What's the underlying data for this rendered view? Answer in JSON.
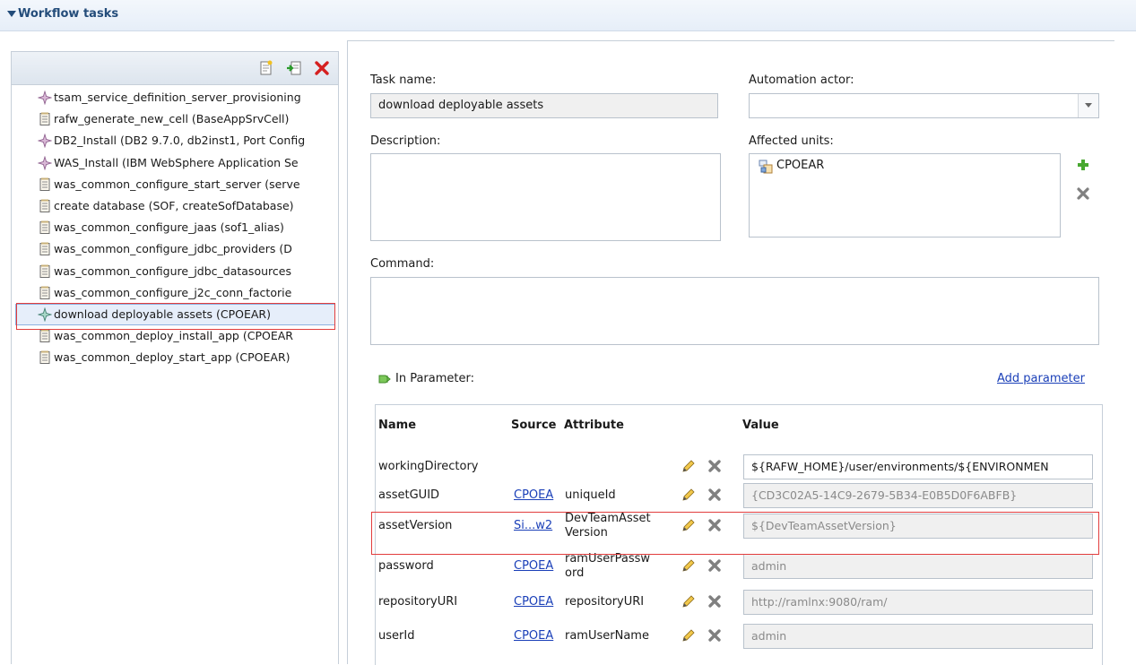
{
  "header": {
    "title": "Workflow tasks"
  },
  "tasks": [
    {
      "label": "tsam_service_definition_server_provisioning",
      "icon": "step-icon"
    },
    {
      "label": "rafw_generate_new_cell (BaseAppSrvCell)",
      "icon": "script-icon"
    },
    {
      "label": "DB2_Install (DB2 9.7.0, db2inst1, Port Config",
      "icon": "step-icon"
    },
    {
      "label": "WAS_Install (IBM WebSphere Application Se",
      "icon": "step-icon"
    },
    {
      "label": "was_common_configure_start_server (serve",
      "icon": "script-icon"
    },
    {
      "label": "create database (SOF, createSofDatabase)",
      "icon": "script-icon"
    },
    {
      "label": "was_common_configure_jaas (sof1_alias)",
      "icon": "script-icon"
    },
    {
      "label": "was_common_configure_jdbc_providers (D",
      "icon": "script-icon"
    },
    {
      "label": "was_common_configure_jdbc_datasources",
      "icon": "script-icon"
    },
    {
      "label": "was_common_configure_j2c_conn_factorie",
      "icon": "script-icon"
    },
    {
      "label": "download deployable assets (CPOEAR)",
      "icon": "step-icon"
    },
    {
      "label": "was_common_deploy_install_app (CPOEAR",
      "icon": "script-icon"
    },
    {
      "label": "was_common_deploy_start_app (CPOEAR)",
      "icon": "script-icon"
    }
  ],
  "details": {
    "task_name_label": "Task name:",
    "task_name_value": "download deployable assets",
    "automation_actor_label": "Automation actor:",
    "automation_actor_value": "",
    "description_label": "Description:",
    "description_value": "",
    "affected_units_label": "Affected units:",
    "affected_unit": "CPOEAR",
    "command_label": "Command:",
    "command_value": ""
  },
  "parameters": {
    "section_label": "In Parameter:",
    "add_label": "Add parameter",
    "columns": {
      "name": "Name",
      "source": "Source",
      "attribute": "Attribute",
      "value": "Value"
    },
    "rows": [
      {
        "name": "workingDirectory",
        "source": "",
        "attr1": "",
        "attr2": "",
        "value": "${RAFW_HOME}/user/environments/${ENVIRONMEN"
      },
      {
        "name": "assetGUID",
        "source": "CPOEA",
        "attr1": "uniqueId",
        "attr2": "",
        "value": "{CD3C02A5-14C9-2679-5B34-E0B5D0F6ABFB}"
      },
      {
        "name": "assetVersion",
        "source": "Si...w2",
        "attr1": "DevTeamAsset",
        "attr2": "Version",
        "value": "${DevTeamAssetVersion}"
      },
      {
        "name": "password",
        "source": "CPOEA",
        "attr1": "ramUserPassw",
        "attr2": "ord",
        "value": "admin"
      },
      {
        "name": "repositoryURI",
        "source": "CPOEA",
        "attr1": "repositoryURI",
        "attr2": "",
        "value": "http://ramlnx:9080/ram/"
      },
      {
        "name": "userId",
        "source": "CPOEA",
        "attr1": "ramUserName",
        "attr2": "",
        "value": "admin"
      }
    ]
  }
}
